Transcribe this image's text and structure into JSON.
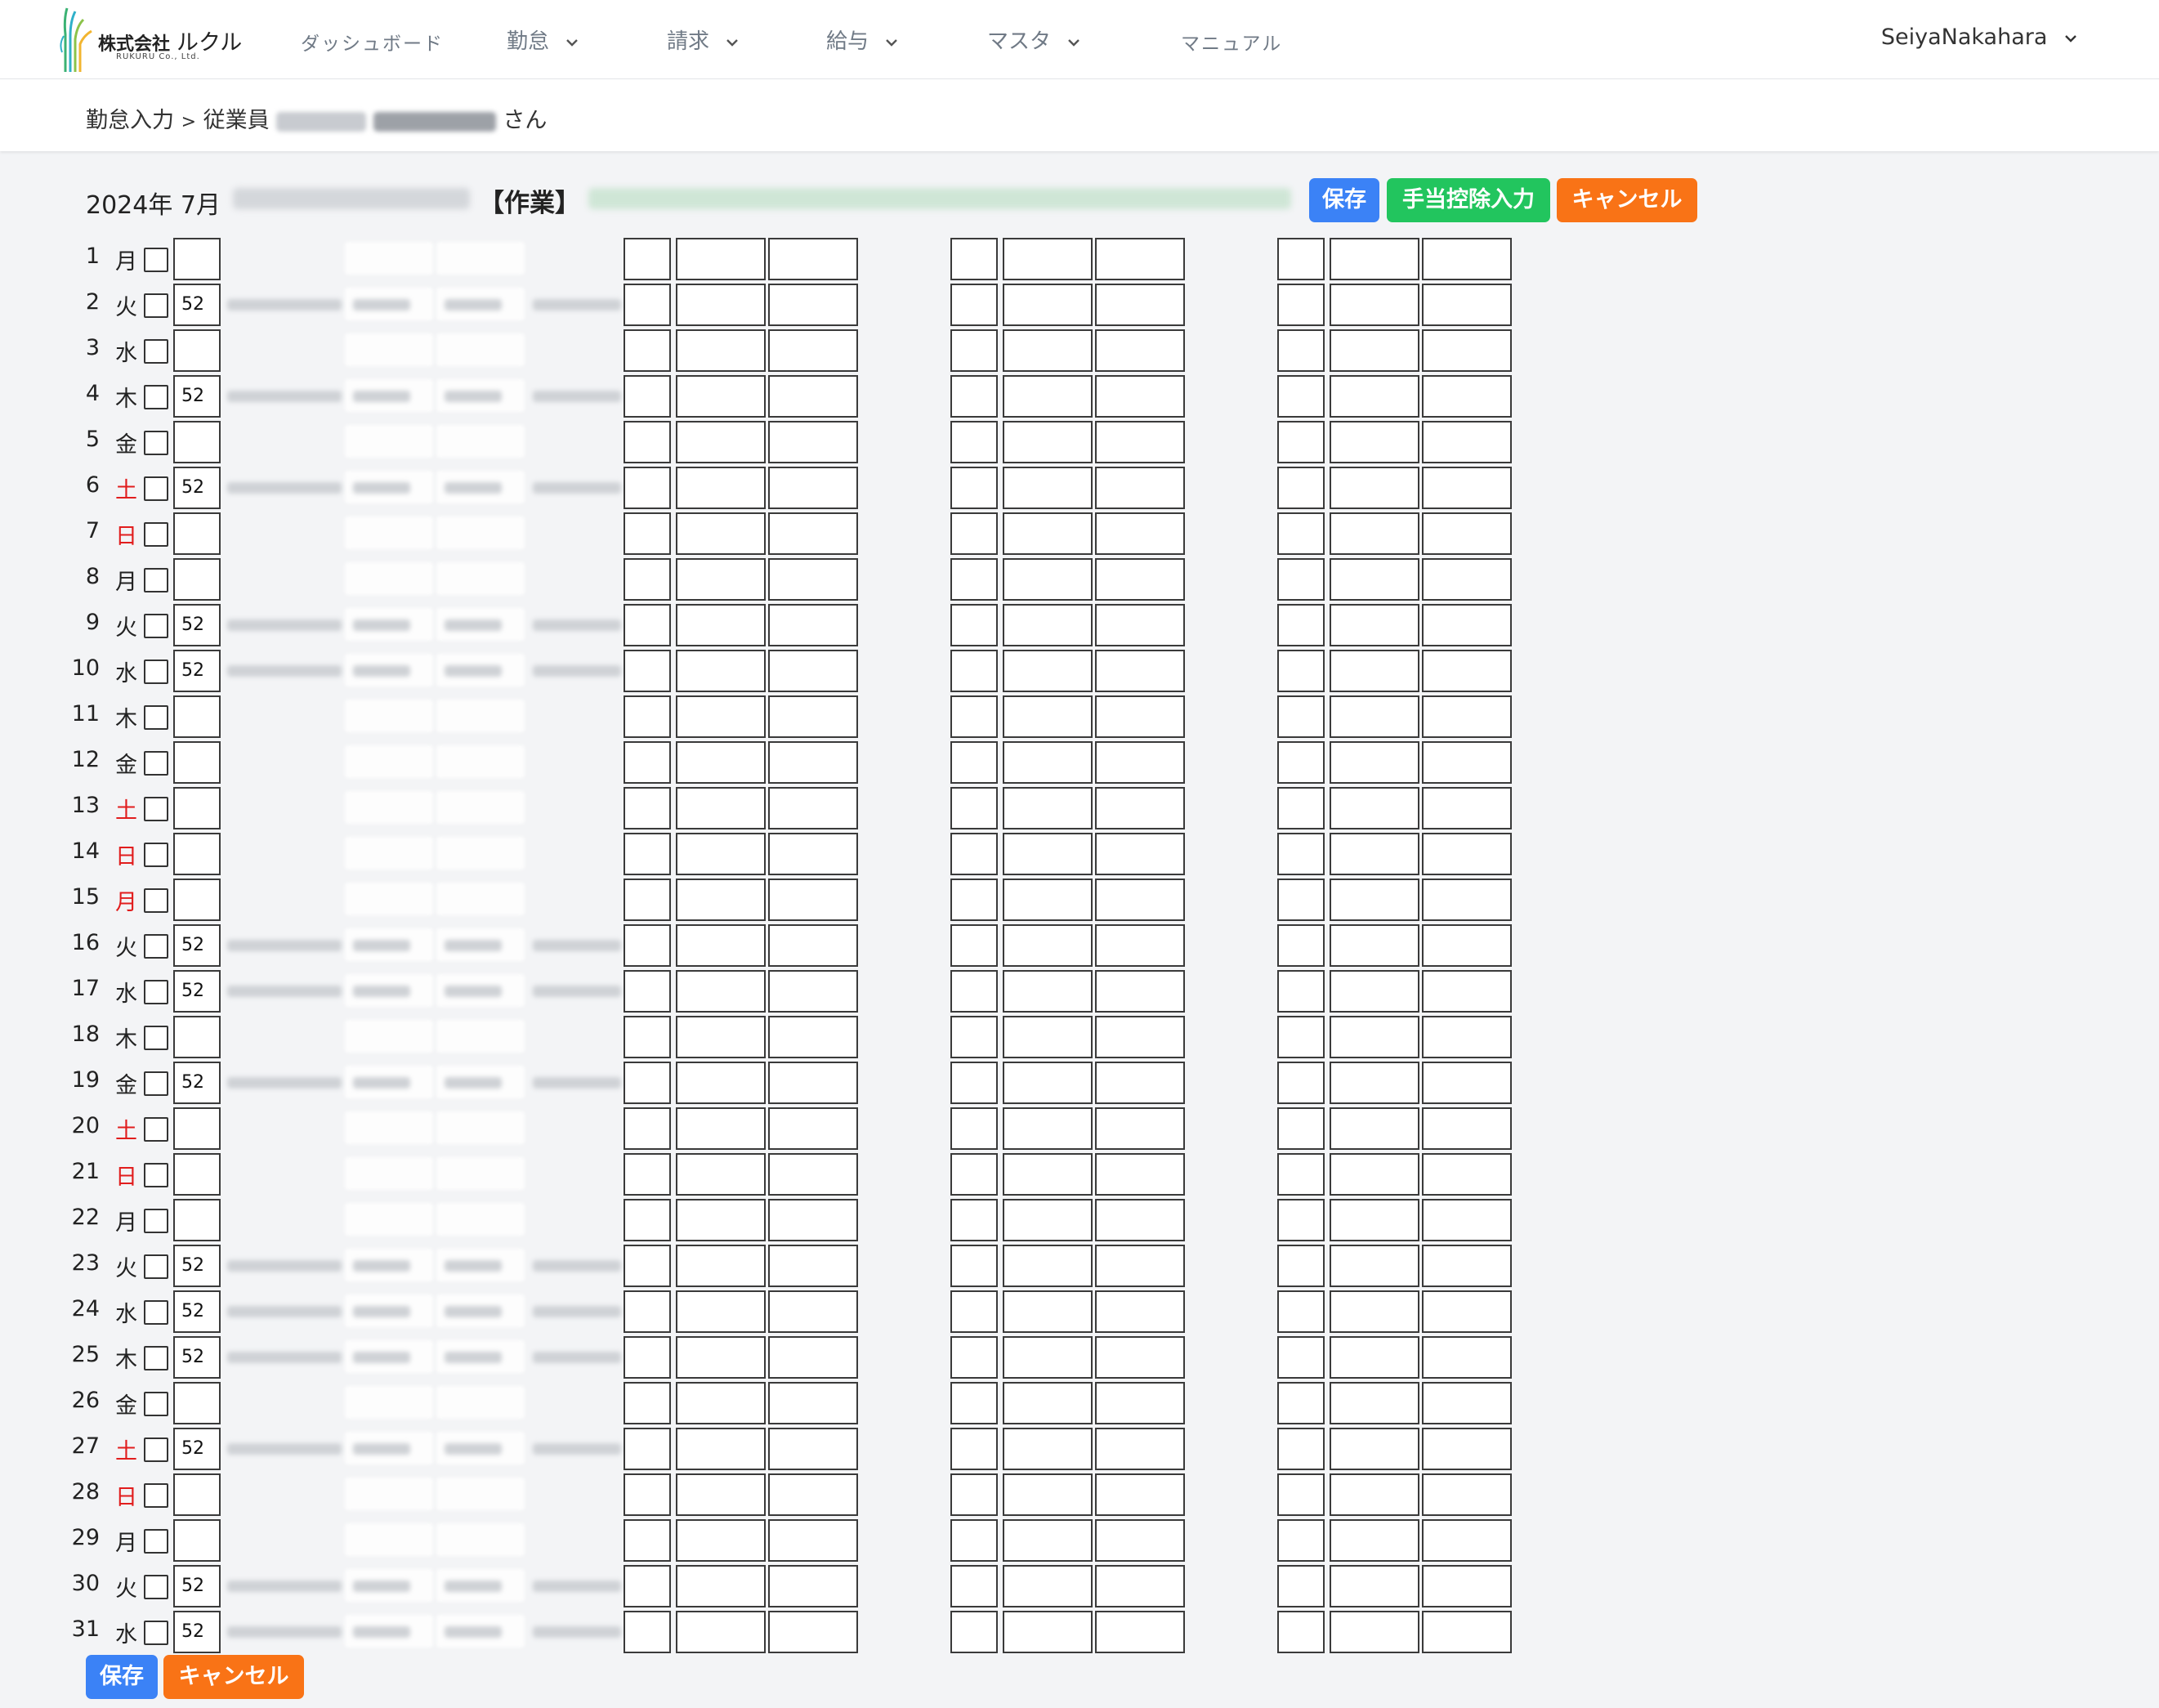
{
  "logo": {
    "company": "株式会社",
    "name": "ルクル",
    "sub": "RUKURU Co., Ltd."
  },
  "nav": {
    "dashboard": "ダッシュボード",
    "attendance": "勤怠",
    "billing": "請求",
    "payroll": "給与",
    "master": "マスタ",
    "manual": "マニュアル"
  },
  "user": {
    "name": "SeiyaNakahara"
  },
  "breadcrumb": {
    "page": "勤怠入力",
    "separator": ">",
    "employee_label": "従業員",
    "suffix": "さん"
  },
  "header": {
    "period": "2024年 7月",
    "work_label": "【作業】"
  },
  "buttons": {
    "save": "保存",
    "allowance": "手当控除入力",
    "cancel": "キャンセル"
  },
  "colors": {
    "weekend": "#e11d1d",
    "save": "#3b82f6",
    "allowance": "#22c55e",
    "cancel": "#f97316"
  },
  "days": [
    {
      "d": "1",
      "w": "月",
      "h": false,
      "code": ""
    },
    {
      "d": "2",
      "w": "火",
      "h": false,
      "code": "52"
    },
    {
      "d": "3",
      "w": "水",
      "h": false,
      "code": ""
    },
    {
      "d": "4",
      "w": "木",
      "h": false,
      "code": "52"
    },
    {
      "d": "5",
      "w": "金",
      "h": false,
      "code": ""
    },
    {
      "d": "6",
      "w": "土",
      "h": true,
      "code": "52"
    },
    {
      "d": "7",
      "w": "日",
      "h": true,
      "code": ""
    },
    {
      "d": "8",
      "w": "月",
      "h": false,
      "code": ""
    },
    {
      "d": "9",
      "w": "火",
      "h": false,
      "code": "52"
    },
    {
      "d": "10",
      "w": "水",
      "h": false,
      "code": "52"
    },
    {
      "d": "11",
      "w": "木",
      "h": false,
      "code": ""
    },
    {
      "d": "12",
      "w": "金",
      "h": false,
      "code": ""
    },
    {
      "d": "13",
      "w": "土",
      "h": true,
      "code": ""
    },
    {
      "d": "14",
      "w": "日",
      "h": true,
      "code": ""
    },
    {
      "d": "15",
      "w": "月",
      "h": true,
      "code": ""
    },
    {
      "d": "16",
      "w": "火",
      "h": false,
      "code": "52"
    },
    {
      "d": "17",
      "w": "水",
      "h": false,
      "code": "52"
    },
    {
      "d": "18",
      "w": "木",
      "h": false,
      "code": ""
    },
    {
      "d": "19",
      "w": "金",
      "h": false,
      "code": "52"
    },
    {
      "d": "20",
      "w": "土",
      "h": true,
      "code": ""
    },
    {
      "d": "21",
      "w": "日",
      "h": true,
      "code": ""
    },
    {
      "d": "22",
      "w": "月",
      "h": false,
      "code": ""
    },
    {
      "d": "23",
      "w": "火",
      "h": false,
      "code": "52"
    },
    {
      "d": "24",
      "w": "水",
      "h": false,
      "code": "52"
    },
    {
      "d": "25",
      "w": "木",
      "h": false,
      "code": "52"
    },
    {
      "d": "26",
      "w": "金",
      "h": false,
      "code": ""
    },
    {
      "d": "27",
      "w": "土",
      "h": true,
      "code": "52"
    },
    {
      "d": "28",
      "w": "日",
      "h": true,
      "code": ""
    },
    {
      "d": "29",
      "w": "月",
      "h": false,
      "code": ""
    },
    {
      "d": "30",
      "w": "火",
      "h": false,
      "code": "52"
    },
    {
      "d": "31",
      "w": "水",
      "h": false,
      "code": "52"
    }
  ]
}
